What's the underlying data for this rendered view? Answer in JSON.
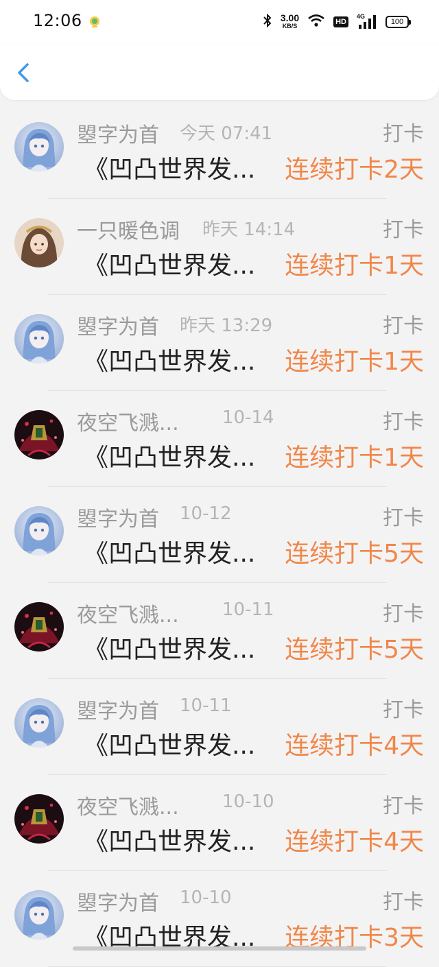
{
  "status_bar": {
    "time": "12:06",
    "net_speed_value": "3.00",
    "net_speed_unit": "KB/S",
    "hd_label": "HD",
    "signal_label": "4G",
    "battery": "100"
  },
  "header": {
    "back_icon": "chevron-left-icon"
  },
  "colors": {
    "accent_orange": "#f0874a",
    "back_blue": "#3d9be9",
    "meta_gray": "#9a9a9a",
    "title_dark": "#222222"
  },
  "entries": [
    {
      "name": "曌字为首",
      "time": "今天 07:41",
      "kind": "打卡",
      "title": "《凹凸世界发...",
      "streak": "连续打卡2天",
      "avatar": "blue-girl"
    },
    {
      "name": "一只暖色调",
      "time": "昨天 14:14",
      "kind": "打卡",
      "title": "《凹凸世界发...",
      "streak": "连续打卡1天",
      "avatar": "brown-girl"
    },
    {
      "name": "曌字为首",
      "time": "昨天 13:29",
      "kind": "打卡",
      "title": "《凹凸世界发...",
      "streak": "连续打卡1天",
      "avatar": "blue-girl"
    },
    {
      "name": "夜空飞溅...",
      "time": "10-14",
      "kind": "打卡",
      "title": "《凹凸世界发...",
      "streak": "连续打卡1天",
      "avatar": "dark-red"
    },
    {
      "name": "曌字为首",
      "time": "10-12",
      "kind": "打卡",
      "title": "《凹凸世界发...",
      "streak": "连续打卡5天",
      "avatar": "blue-girl"
    },
    {
      "name": "夜空飞溅...",
      "time": "10-11",
      "kind": "打卡",
      "title": "《凹凸世界发...",
      "streak": "连续打卡5天",
      "avatar": "dark-red"
    },
    {
      "name": "曌字为首",
      "time": "10-11",
      "kind": "打卡",
      "title": "《凹凸世界发...",
      "streak": "连续打卡4天",
      "avatar": "blue-girl"
    },
    {
      "name": "夜空飞溅...",
      "time": "10-10",
      "kind": "打卡",
      "title": "《凹凸世界发...",
      "streak": "连续打卡4天",
      "avatar": "dark-red"
    },
    {
      "name": "曌字为首",
      "time": "10-10",
      "kind": "打卡",
      "title": "《凹凸世界发...",
      "streak": "连续打卡3天",
      "avatar": "blue-girl"
    }
  ]
}
